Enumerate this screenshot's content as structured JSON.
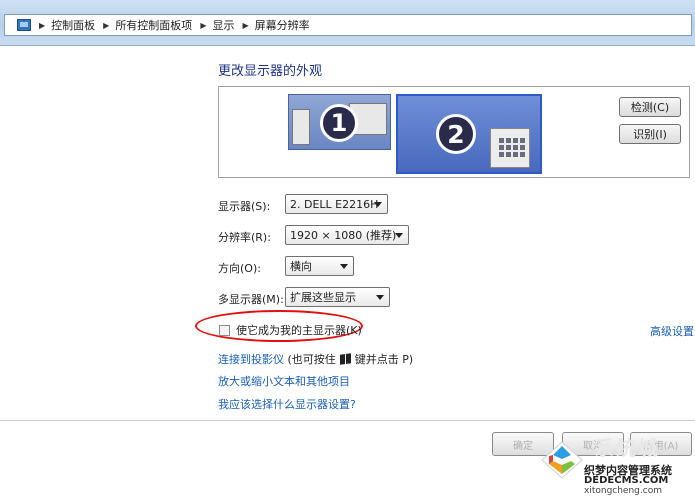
{
  "breadcrumb": {
    "items": [
      "控制面板",
      "所有控制面板项",
      "显示",
      "屏幕分辨率"
    ]
  },
  "page": {
    "title": "更改显示器的外观"
  },
  "preview": {
    "monitor1_number": "1",
    "monitor2_number": "2",
    "detect_label": "检测(C)",
    "identify_label": "识别(I)"
  },
  "settings": {
    "display_label": "显示器(S):",
    "display_value": "2. DELL E2216H",
    "resolution_label": "分辨率(R):",
    "resolution_value": "1920 × 1080 (推荐)",
    "orientation_label": "方向(O):",
    "orientation_value": "横向",
    "multi_label": "多显示器(M):",
    "multi_value": "扩展这些显示",
    "primary_checkbox_label": "使它成为我的主显示器(K)",
    "primary_checked": false,
    "advanced_label": "高级设置"
  },
  "links": {
    "projector": "连接到投影仪",
    "projector_note_1": "(也可按住",
    "projector_note_2": "键并点击 P)",
    "text_size": "放大或缩小文本和其他项目",
    "which_settings": "我应该选择什么显示器设置?"
  },
  "footer": {
    "ok": "确定",
    "cancel": "取消",
    "apply": "应用(A)"
  },
  "watermark": {
    "big": "系统城",
    "cn": "织梦内容管理系统",
    "site": "DEDECMS.COM",
    "site2": "xitongcheng.com"
  },
  "colors": {
    "link": "#1a5fb4",
    "heading": "#1e3287",
    "highlight_oval": "#e01010",
    "selected_monitor_border": "#2f59c9"
  }
}
